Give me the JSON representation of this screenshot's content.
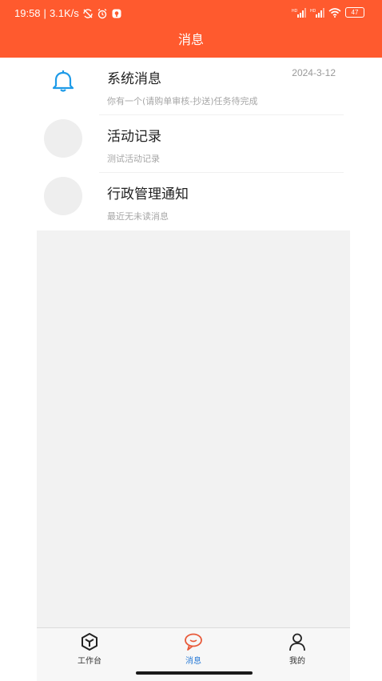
{
  "status_bar": {
    "time": "19:58",
    "network_speed": "3.1K/s",
    "battery": "47"
  },
  "header": {
    "title": "消息"
  },
  "messages": [
    {
      "title": "系统消息",
      "subtitle": "你有一个(请购单审核-抄送)任务待完成",
      "date": "2024-3-12",
      "icon": "bell-icon"
    },
    {
      "title": "活动记录",
      "subtitle": "测试活动记录",
      "date": "",
      "icon": "avatar-placeholder"
    },
    {
      "title": "行政管理通知",
      "subtitle": "最近无未读消息",
      "date": "",
      "icon": "avatar-placeholder"
    }
  ],
  "tabs": [
    {
      "label": "工作台",
      "icon": "cube-icon",
      "active": false
    },
    {
      "label": "消息",
      "icon": "chat-bubble-icon",
      "active": true
    },
    {
      "label": "我的",
      "icon": "person-icon",
      "active": false
    }
  ],
  "colors": {
    "brand": "#ff5a2e",
    "active_tab": "#2a7bd6",
    "active_icon": "#e85a3a"
  }
}
